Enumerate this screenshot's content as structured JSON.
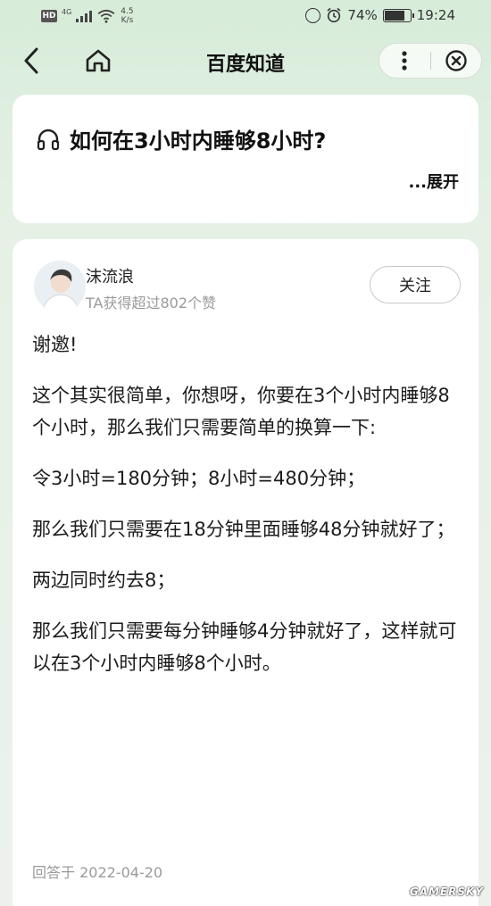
{
  "status_bar": {
    "hd": "HD",
    "network": "4G",
    "speed_value": "4.5",
    "speed_unit": "K/s",
    "battery": "74%",
    "time": "19:24"
  },
  "nav": {
    "title": "百度知道"
  },
  "question": {
    "title": "如何在3小时内睡够8小时?",
    "expand_label": "...展开"
  },
  "answer": {
    "author": "沫流浪",
    "author_stats": "TA获得超过802个赞",
    "follow_label": "关注",
    "paragraphs": [
      "谢邀!",
      "这个其实很简单，你想呀，你要在3个小时内睡够8个小时，那么我们只需要简单的换算一下:",
      "令3小时=180分钟；8小时=480分钟；",
      "那么我们只需要在18分钟里面睡够48分钟就好了；",
      "两边同时约去8；",
      "那么我们只需要每分钟睡够4分钟就好了，这样就可以在3个小时内睡够8个小时。"
    ],
    "answered_date": "回答于 2022-04-20"
  },
  "watermark": "GAMERSKY",
  "icons": [
    "back-icon",
    "home-icon",
    "more-icon",
    "close-icon",
    "headphone-icon",
    "wifi-icon",
    "alarm-icon",
    "battery-icon"
  ]
}
